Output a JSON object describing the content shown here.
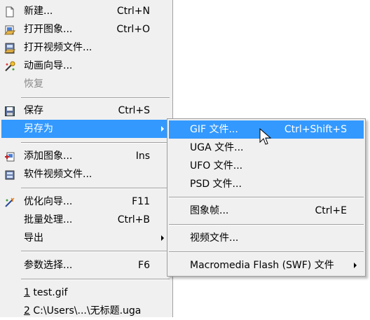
{
  "main_menu": {
    "new_label": "新建...",
    "new_shortcut": "Ctrl+N",
    "open_image_label": "打开图象...",
    "open_image_shortcut": "Ctrl+O",
    "open_video_label": "打开视频文件...",
    "animation_wizard_label": "动画向导...",
    "restore_label": "恢复",
    "save_label": "保存",
    "save_shortcut": "Ctrl+S",
    "save_as_label": "另存为",
    "add_image_label": "添加图象...",
    "add_image_shortcut": "Ins",
    "software_video_label": "软件视频文件...",
    "optimize_label": "优化向导...",
    "optimize_shortcut": "F11",
    "batch_label": "批量处理...",
    "batch_shortcut": "Ctrl+B",
    "export_label": "导出",
    "preferences_label": "参数选择...",
    "preferences_shortcut": "F6",
    "recent1_num": "1",
    "recent1_label": " test.gif",
    "recent2_num": "2",
    "recent2_label": " C:\\Users\\...\\无标题.uga"
  },
  "save_as_submenu": {
    "gif_label": "GIF 文件...",
    "gif_shortcut": "Ctrl+Shift+S",
    "uga_label": "UGA 文件...",
    "ufo_label": "UFO 文件...",
    "psd_label": "PSD 文件...",
    "frame_label": "图象帧...",
    "frame_shortcut": "Ctrl+E",
    "video_label": "视频文件...",
    "flash_label": "Macromedia Flash (SWF) 文件"
  },
  "colors": {
    "highlight": "#3399ff",
    "menu_bg": "#f0f0f0",
    "disabled_text": "#8a8a8a"
  },
  "icons": [
    "new-file-icon",
    "open-image-icon",
    "open-video-icon",
    "animation-wizard-icon",
    "save-icon",
    "add-image-icon",
    "software-video-icon",
    "optimize-wizard-icon",
    "mouse-cursor-icon"
  ]
}
